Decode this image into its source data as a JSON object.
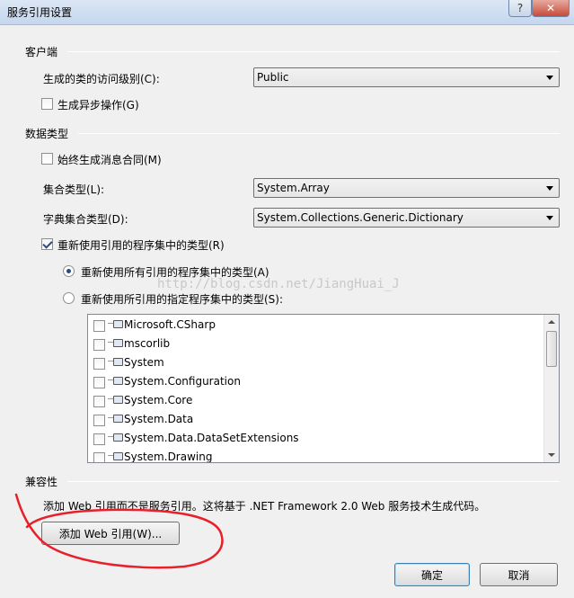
{
  "window": {
    "title": "服务引用设置",
    "help_button": "?",
    "close_button": "✕"
  },
  "client_section": {
    "header": "客户端",
    "access_level_label": "生成的类的访问级别(C):",
    "access_level_value": "Public",
    "async_label": "生成异步操作(G)",
    "async_checked": false
  },
  "data_type_section": {
    "header": "数据类型",
    "always_generate_label": "始终生成消息合同(M)",
    "always_generate_checked": false,
    "collection_type_label": "集合类型(L):",
    "collection_type_value": "System.Array",
    "dictionary_type_label": "字典集合类型(D):",
    "dictionary_type_value": "System.Collections.Generic.Dictionary",
    "reuse_types_label": "重新使用引用的程序集中的类型(R)",
    "reuse_types_checked": true,
    "reuse_all_label": "重新使用所有引用的程序集中的类型(A)",
    "reuse_all_selected": true,
    "reuse_specified_label": "重新使用所引用的指定程序集中的类型(S):",
    "reuse_specified_selected": false,
    "assemblies": [
      "Microsoft.CSharp",
      "mscorlib",
      "System",
      "System.Configuration",
      "System.Core",
      "System.Data",
      "System.Data.DataSetExtensions",
      "System.Drawing"
    ]
  },
  "compat_section": {
    "header": "兼容性",
    "description": "添加 Web 引用而不是服务引用。这将基于 .NET Framework 2.0 Web 服务技术生成代码。",
    "add_web_ref_button": "添加 Web 引用(W)..."
  },
  "footer": {
    "ok_button": "确定",
    "cancel_button": "取消"
  },
  "watermark": "http://blog.csdn.net/JiangHuai_J",
  "colors": {
    "annotation_red": "#e8202a",
    "titlebar": "#c5d7ee",
    "dialog_bg": "#f0f0f0"
  }
}
